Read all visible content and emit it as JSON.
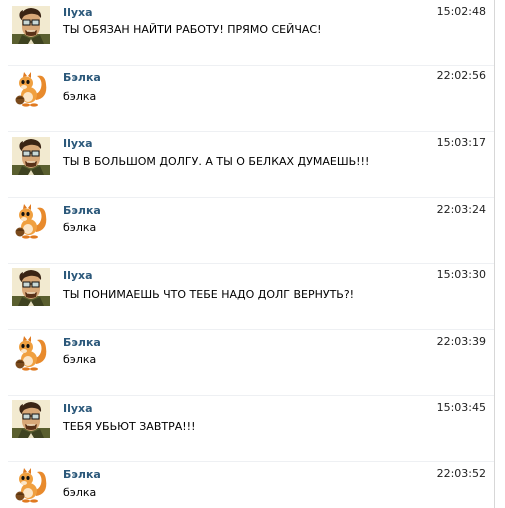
{
  "messages": [
    {
      "author": "Ilyxa",
      "avatar": "man-with-glasses-avatar",
      "text": "ТЫ ОБЯЗАН НАЙТИ РАБОТУ! ПРЯМО СЕЙЧАС!",
      "time": "15:02:48"
    },
    {
      "author": "Бэлка",
      "avatar": "squirrel-avatar",
      "text": "бэлка",
      "time": "22:02:56"
    },
    {
      "author": "Ilyxa",
      "avatar": "man-with-glasses-avatar",
      "text": "ТЫ В БОЛЬШОМ ДОЛГУ. А ТЫ О БЕЛКАХ ДУМАЕШЬ!!!",
      "time": "15:03:17"
    },
    {
      "author": "Бэлка",
      "avatar": "squirrel-avatar",
      "text": "бэлка",
      "time": "22:03:24"
    },
    {
      "author": "Ilyxa",
      "avatar": "man-with-glasses-avatar",
      "text": "ТЫ ПОНИМАЕШЬ ЧТО ТЕБЕ НАДО ДОЛГ ВЕРНУТЬ?!",
      "time": "15:03:30"
    },
    {
      "author": "Бэлка",
      "avatar": "squirrel-avatar",
      "text": "бэлка",
      "time": "22:03:39"
    },
    {
      "author": "Ilyxa",
      "avatar": "man-with-glasses-avatar",
      "text": "ТЕБЯ УБЬЮТ ЗАВТРА!!!",
      "time": "15:03:45"
    },
    {
      "author": "Бэлка",
      "avatar": "squirrel-avatar",
      "text": "бэлка",
      "time": "22:03:52"
    }
  ]
}
